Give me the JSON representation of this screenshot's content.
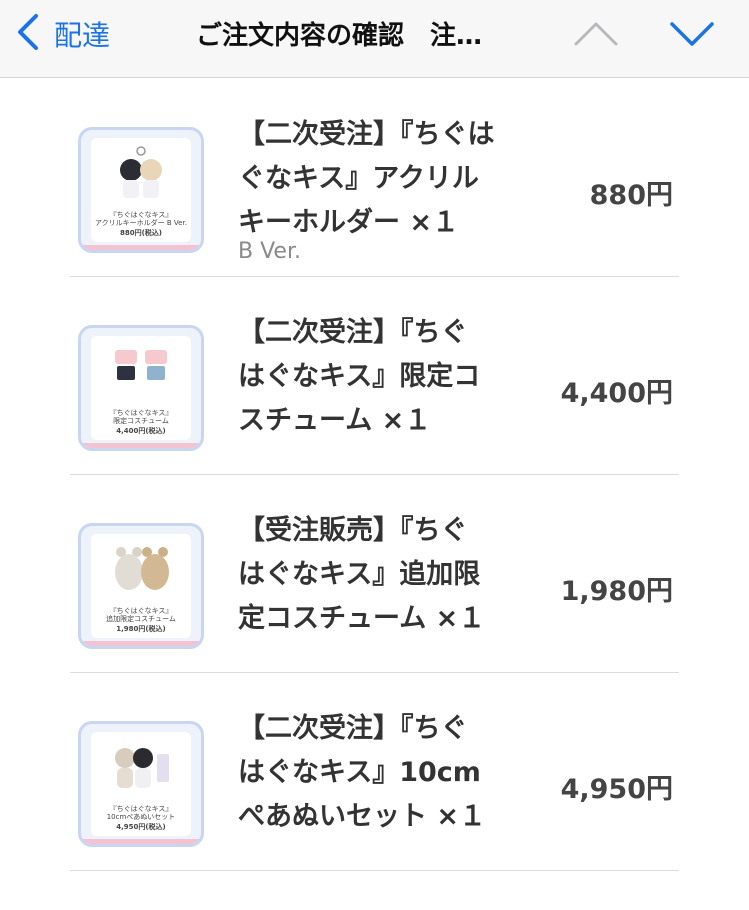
{
  "navbar": {
    "back_label": "配達",
    "title": "ご注文内容の確認　注…",
    "back_icon": "chevron-left-icon",
    "up_icon": "chevron-up-icon",
    "down_icon": "chevron-down-icon",
    "accent_color": "#1a73e8"
  },
  "items": [
    {
      "name_lines": [
        "【二次受注】『ちぐは",
        "ぐなキス』アクリル",
        "キーホルダー ×１"
      ],
      "variant": "B Ver.",
      "price": "880円",
      "thumb": {
        "cap1": "『ちぐはぐなキス』",
        "cap2": "アクリルキーホルダー B Ver.",
        "cap3": "880円(税込)"
      }
    },
    {
      "name_lines": [
        "【二次受注】『ちぐ",
        "はぐなキス』限定コ",
        "スチューム ×１"
      ],
      "variant": "",
      "price": "4,400円",
      "thumb": {
        "cap1": "『ちぐはぐなキス』",
        "cap2": "限定コスチューム",
        "cap3": "4,400円(税込)"
      }
    },
    {
      "name_lines": [
        "【受注販売】『ちぐ",
        "はぐなキス』追加限",
        "定コスチューム ×１"
      ],
      "variant": "",
      "price": "1,980円",
      "thumb": {
        "cap1": "『ちぐはぐなキス』",
        "cap2": "追加限定コスチューム",
        "cap3": "1,980円(税込)"
      }
    },
    {
      "name_lines": [
        "【二次受注】『ちぐ",
        "はぐなキス』10cm",
        "ぺあぬいセット ×１"
      ],
      "variant": "",
      "price": "4,950円",
      "thumb": {
        "cap1": "『ちぐはぐなキス』",
        "cap2": "10cmぺあぬいセット",
        "cap3": "4,950円(税込)"
      }
    }
  ]
}
